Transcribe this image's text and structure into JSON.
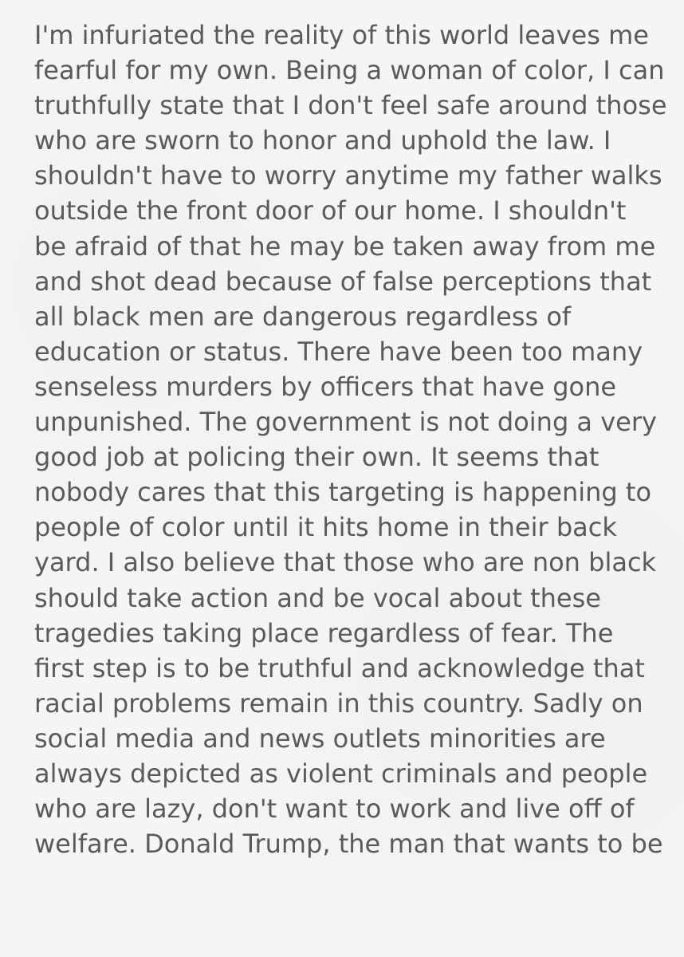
{
  "note": {
    "lines": [
      "I'm infuriated the reality of this world leaves me",
      "fearful for my own. Being a woman of color, I can",
      "truthfully state that I don't feel safe around those",
      "who are sworn to honor and uphold the law. I",
      "shouldn't have to worry anytime my father walks",
      "outside the front door of our home. I shouldn't",
      "be afraid of that he may be taken away from me",
      "and shot dead because of false perceptions that",
      "all black men are dangerous regardless of",
      "education or status. There have been too many",
      "senseless murders by officers that have gone",
      "unpunished. The government is not doing a very",
      "good job at policing their own. It seems that",
      "nobody cares that this targeting is happening to",
      "people of color until it hits home in their back",
      "yard. I also believe that those who are non black",
      "should take action and be vocal about these",
      "tragedies taking place regardless of fear. The",
      "first step is to be truthful and acknowledge that",
      "racial problems remain in this country. Sadly on",
      "social media and news outlets minorities are",
      "always depicted as violent criminals and people",
      "who are lazy, don't want to work and live off of",
      "welfare. Donald Trump, the man that wants to be"
    ]
  }
}
